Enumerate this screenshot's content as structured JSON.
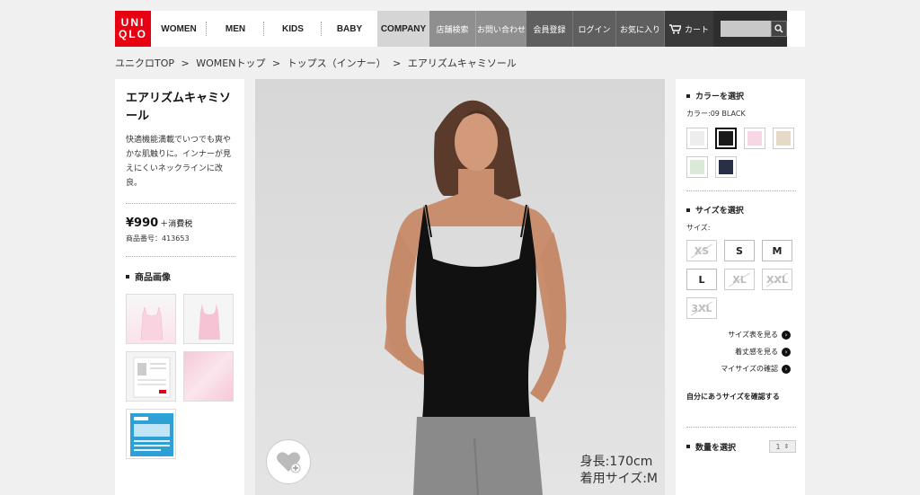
{
  "header": {
    "logo_top": "UNI",
    "logo_bottom": "QLO",
    "nav": {
      "women": "WOMEN",
      "men": "MEN",
      "kids": "KIDS",
      "baby": "BABY",
      "company": "COMPANY",
      "store_search": "店舗検索",
      "contact": "お問い合わせ",
      "register": "会員登録",
      "login": "ログイン",
      "favorites": "お気に入り",
      "cart": "カート"
    }
  },
  "breadcrumb": [
    "ユニクロTOP",
    ">",
    "WOMENトップ",
    ">",
    "トップス（インナー）",
    ">",
    "エアリズムキャミソール"
  ],
  "product": {
    "title": "エアリズムキャミソール",
    "description": "快適機能満載でいつでも爽やかな肌触りに。インナーが見えにくいネックラインに改良。",
    "price": "¥990",
    "tax_note": "＋消費税",
    "sku": "商品番号：413653",
    "images_heading": "商品画像"
  },
  "main_image": {
    "model_height": "身長:170cm",
    "model_size": "着用サイズ:M"
  },
  "options": {
    "color_heading": "カラーを選択",
    "color_label": "カラー:09 BLACK",
    "colors": [
      "#ededed",
      "#1a1a1a",
      "#f7d7e3",
      "#e6d9c7",
      "#d9ebd6",
      "#2a2f48"
    ],
    "size_heading": "サイズを選択",
    "size_label": "サイズ:",
    "sizes": [
      {
        "label": "XS",
        "available": false
      },
      {
        "label": "S",
        "available": true
      },
      {
        "label": "M",
        "available": true
      },
      {
        "label": "L",
        "available": true
      },
      {
        "label": "XL",
        "available": false
      },
      {
        "label": "XXL",
        "available": false
      },
      {
        "label": "3XL",
        "available": false
      }
    ],
    "size_chart_link": "サイズ表を見る",
    "fit_link": "着丈感を見る",
    "my_size_link": "マイサイズの確認",
    "find_size_link": "自分にあうサイズを確認する",
    "qty_heading": "数量を選択",
    "qty_value": "1"
  }
}
